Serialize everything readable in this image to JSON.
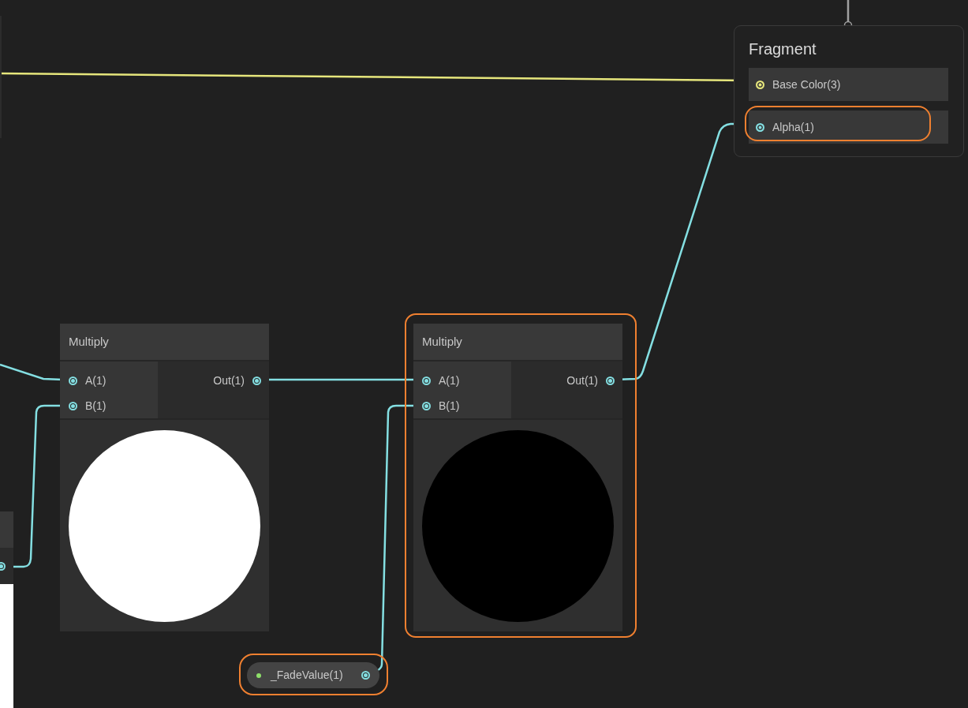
{
  "fragment": {
    "title": "Fragment",
    "ports": [
      {
        "label": "Base Color(3)",
        "color": "#e6e67c",
        "highlighted": false
      },
      {
        "label": "Alpha(1)",
        "color": "#84dfe2",
        "highlighted": true
      }
    ]
  },
  "nodes": [
    {
      "title": "Multiply",
      "inputs": [
        "A(1)",
        "B(1)"
      ],
      "output": "Out(1)",
      "color": "#ffffff",
      "highlighted": false
    },
    {
      "title": "Multiply",
      "inputs": [
        "A(1)",
        "B(1)"
      ],
      "output": "Out(1)",
      "color": "#000000",
      "highlighted": true
    }
  ],
  "property": {
    "label": "_FadeValue(1)",
    "highlighted": true
  }
}
